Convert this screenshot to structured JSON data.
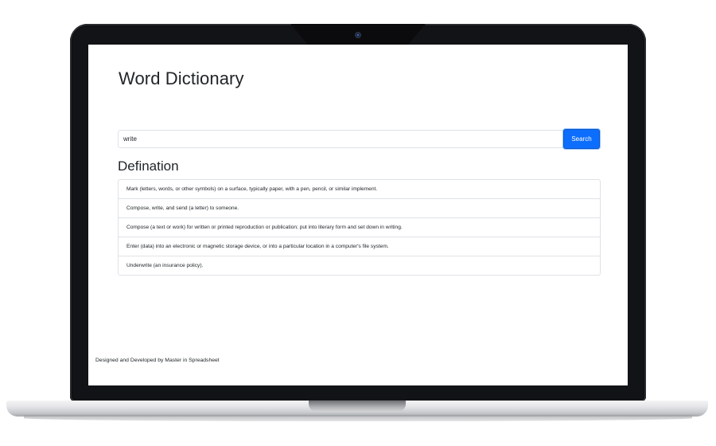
{
  "app": {
    "title": "Word Dictionary"
  },
  "search": {
    "value": "write",
    "button_label": "Search"
  },
  "definitions": {
    "heading": "Defination",
    "items": [
      "Mark (letters, words, or other symbols) on a surface, typically paper, with a pen, pencil, or similar implement.",
      "Compose, write, and send (a letter) to someone.",
      "Compose (a text or work) for written or printed reproduction or publication; put into literary form and set down in writing.",
      "Enter (data) into an electronic or magnetic storage device, or into a particular location in a computer's file system.",
      "Underwrite (an insurance policy)."
    ]
  },
  "footer": {
    "text": "Designed and Developed by Master in Spreadsheet"
  },
  "colors": {
    "accent": "#0d6efd",
    "text": "#212529",
    "border": "#dee2e6",
    "bezel": "#121316"
  },
  "icons": {
    "camera": "camera-icon"
  }
}
